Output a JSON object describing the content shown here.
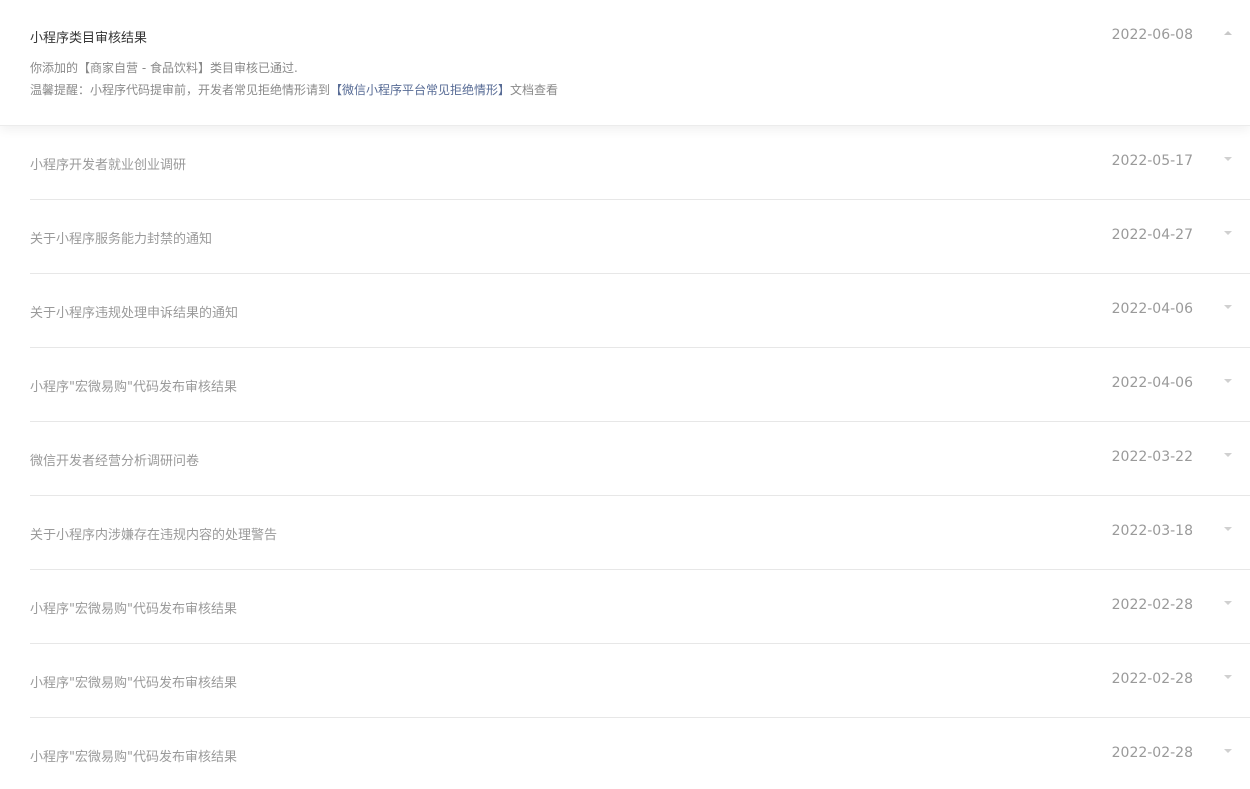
{
  "expanded_notice": {
    "title": "小程序类目审核结果",
    "date": "2022-06-08",
    "line1": "你添加的【商家自营 - 食品饮料】类目审核已通过.",
    "line2_prefix": "温馨提醒：小程序代码提审前，开发者常见拒绝情形请到",
    "line2_link": "【微信小程序平台常见拒绝情形】",
    "line2_suffix": "文档查看",
    "arrow_icon": "chevron-up-icon"
  },
  "notices": [
    {
      "title": "小程序开发者就业创业调研",
      "date": "2022-05-17"
    },
    {
      "title": "关于小程序服务能力封禁的通知",
      "date": "2022-04-27"
    },
    {
      "title": "关于小程序违规处理申诉结果的通知",
      "date": "2022-04-06"
    },
    {
      "title": "小程序\"宏微易购\"代码发布审核结果",
      "date": "2022-04-06"
    },
    {
      "title": "微信开发者经营分析调研问卷",
      "date": "2022-03-22"
    },
    {
      "title": "关于小程序内涉嫌存在违规内容的处理警告",
      "date": "2022-03-18"
    },
    {
      "title": "小程序\"宏微易购\"代码发布审核结果",
      "date": "2022-02-28"
    },
    {
      "title": "小程序\"宏微易购\"代码发布审核结果",
      "date": "2022-02-28"
    },
    {
      "title": "小程序\"宏微易购\"代码发布审核结果",
      "date": "2022-02-28"
    }
  ],
  "colors": {
    "link": "#576b95",
    "title_active": "#353535",
    "muted_text": "#9a9a9a",
    "divider": "#e7e7e7"
  }
}
